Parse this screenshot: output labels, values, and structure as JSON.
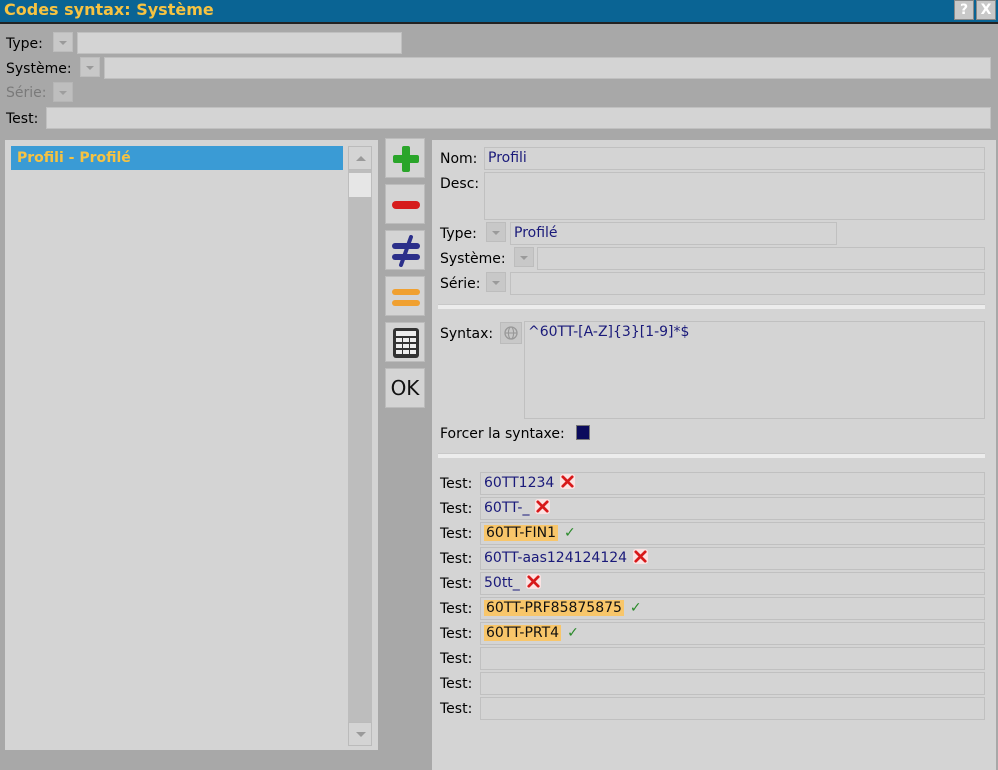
{
  "window": {
    "title": "Codes syntax: Système",
    "help_label": "?",
    "close_label": "X"
  },
  "filters": {
    "type_label": "Type:",
    "type_value": "",
    "systeme_label": "Système:",
    "systeme_value": "",
    "serie_label": "Série:",
    "test_label": "Test:",
    "test_value": ""
  },
  "list": {
    "items": [
      {
        "label": "Profili - Profilé",
        "selected": true
      }
    ]
  },
  "toolbar": {
    "add_icon": "plus-icon",
    "remove_icon": "minus-icon",
    "not_equal_icon": "not-equal-icon",
    "equal_icon": "equal-icon",
    "calculator_icon": "calculator-icon",
    "ok_label": "OK"
  },
  "detail": {
    "nom_label": "Nom:",
    "nom_value": "Profili",
    "desc_label": "Desc:",
    "desc_value": "",
    "type_label": "Type:",
    "type_value": "Profilé",
    "systeme_label": "Système:",
    "systeme_value": "",
    "serie_label": "Série:",
    "serie_value": "",
    "syntax_label": "Syntax:",
    "syntax_value": "^60TT-[A-Z]{3}[1-9]*$",
    "forcer_label": "Forcer la syntaxe:",
    "forcer_checked": true
  },
  "tests": {
    "label": "Test:",
    "rows": [
      {
        "value": "60TT1234",
        "status": "fail"
      },
      {
        "value": "60TT-_",
        "status": "fail"
      },
      {
        "value": "60TT-FIN1",
        "status": "pass"
      },
      {
        "value": "60TT-aas124124124",
        "status": "fail"
      },
      {
        "value": "50tt_",
        "status": "fail"
      },
      {
        "value": "60TT-PRF85875875",
        "status": "pass"
      },
      {
        "value": "60TT-PRT4",
        "status": "pass"
      },
      {
        "value": "",
        "status": "none"
      },
      {
        "value": "",
        "status": "none"
      },
      {
        "value": "",
        "status": "none"
      }
    ]
  },
  "colors": {
    "title_bar": "#0a6494",
    "title_text": "#f6c342",
    "selection": "#3a9bd5",
    "match_highlight": "#f8c66a",
    "value_text": "#1a1a7a"
  }
}
